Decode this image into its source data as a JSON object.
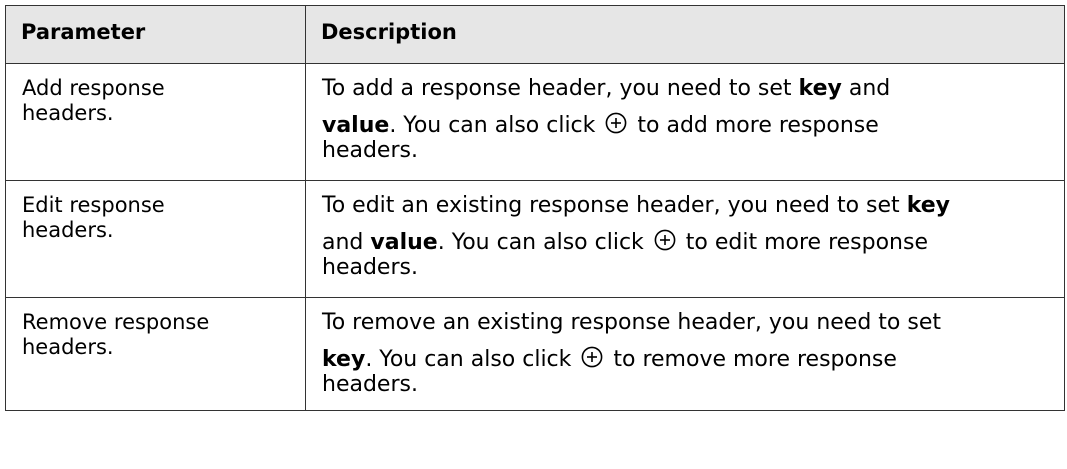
{
  "table": {
    "headers": {
      "parameter": "Parameter",
      "description": "Description"
    },
    "rows": [
      {
        "parameter": "Add response headers.",
        "param_line1": "Add response",
        "param_line2": "headers.",
        "line1_a": "To add a response header, you need to set ",
        "line1_b": "key",
        "line1_c": " and",
        "line2_a": "value",
        "line2_b": ". You can also click ",
        "line2_c": " to add more response",
        "line3": "headers."
      },
      {
        "parameter": "Edit response headers.",
        "param_line1": "Edit response",
        "param_line2": "headers.",
        "line1_a": "To edit an existing response header, you need to set ",
        "line1_b": "key",
        "line2_a": "and ",
        "line2_b": "value",
        "line2_c": ". You can also click ",
        "line2_d": " to edit more response",
        "line3": "headers."
      },
      {
        "parameter": "Remove response headers.",
        "param_line1": "Remove response",
        "param_line2": "headers.",
        "line1_a": "To remove an existing response header, you need to set",
        "line2_a": "key",
        "line2_b": ". You can also click ",
        "line2_c": " to remove more response",
        "line3": "headers."
      }
    ],
    "icon": "plus-circle-icon"
  }
}
